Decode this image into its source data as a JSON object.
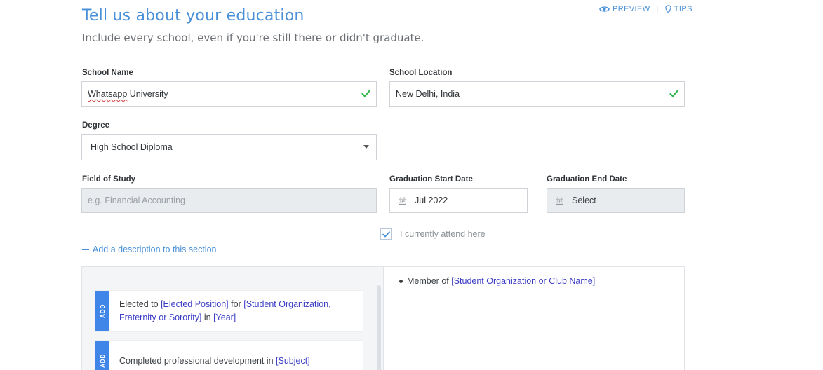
{
  "header": {
    "title": "Tell us about your education",
    "subtitle": "Include every school, even if you're still there or didn't graduate.",
    "preview_label": "PREVIEW",
    "tips_label": "TIPS",
    "separator": "|"
  },
  "form": {
    "school_name": {
      "label": "School Name",
      "value": "Whatsapp University",
      "value_misspelled": "Whatsapp",
      "value_rest": " University"
    },
    "school_location": {
      "label": "School Location",
      "value": "New Delhi, India"
    },
    "degree": {
      "label": "Degree",
      "value": "High School Diploma"
    },
    "field_of_study": {
      "label": "Field of Study",
      "placeholder": "e.g. Financial Accounting"
    },
    "graduation_start": {
      "label": "Graduation Start Date",
      "value": "Jul 2022"
    },
    "graduation_end": {
      "label": "Graduation End Date",
      "value": "Select"
    },
    "currently_attend": {
      "label": "I currently attend here",
      "checked": true
    },
    "add_description_label": "Add a description to this section"
  },
  "suggestions": {
    "add_tab": "ADD",
    "items": [
      {
        "parts": [
          "Elected to ",
          "[Elected Position]",
          " for ",
          "[Student Organization,",
          " ",
          "Fraternity or Sorority]",
          " in ",
          "[Year]"
        ]
      },
      {
        "parts": [
          "Completed professional development in ",
          "[Subject]"
        ]
      }
    ]
  },
  "editor": {
    "bullets": [
      {
        "text": "Member of ",
        "placeholder": "[Student Organization or Club Name]"
      }
    ]
  },
  "colors": {
    "accent": "#4a90d9",
    "check": "#2eb84b",
    "add_tab": "#3f86e8",
    "placeholder": "#3b3cc4"
  },
  "icons": {
    "preview": "eye-icon",
    "tips": "lightbulb-icon",
    "valid": "checkmark-icon",
    "calendar": "calendar-icon",
    "dropdown": "caret-down-icon"
  }
}
